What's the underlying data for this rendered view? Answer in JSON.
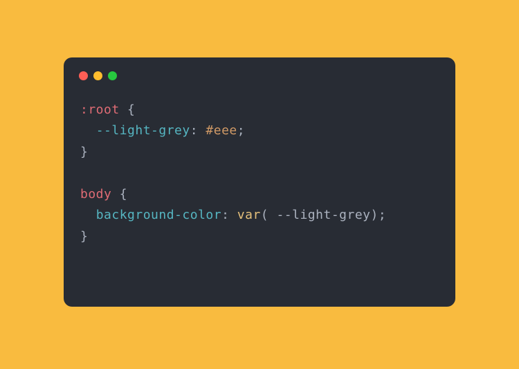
{
  "code": {
    "line1": {
      "selector": ":root",
      "brace": " {"
    },
    "line2": {
      "indent": "  ",
      "property": "--light-grey",
      "colon": ": ",
      "value": "#eee",
      "semi": ";"
    },
    "line3": {
      "brace": "}"
    },
    "line5": {
      "selector": "body",
      "brace": " {"
    },
    "line6": {
      "indent": "  ",
      "property": "background-color",
      "colon": ": ",
      "func": "var",
      "paren_open": "(",
      "arg": " --light-grey",
      "paren_close": ")",
      "semi": ";"
    },
    "line7": {
      "brace": "}"
    }
  }
}
